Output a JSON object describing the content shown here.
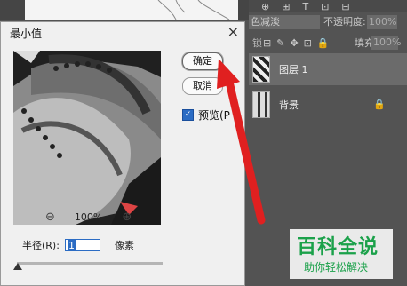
{
  "dialog": {
    "title": "最小值",
    "close_glyph": "×",
    "ok_label": "确定",
    "cancel_label": "取消",
    "preview_label": "预览(P",
    "preview_checked": true,
    "zoom_out_glyph": "⊖",
    "zoom_level": "100%",
    "zoom_in_glyph": "⊕",
    "radius_label": "半径(R):",
    "radius_value": "1",
    "radius_unit": "像素",
    "slider_level": 0
  },
  "layers_panel": {
    "tab_glyphs": [
      "⊕",
      "⊞",
      "T",
      "⊡",
      "⊟"
    ],
    "blend_mode": "色减淡",
    "opacity_label": "不透明度:",
    "opacity_value": "100%",
    "lock_label": "锁",
    "lock_icons": [
      "⊞",
      "✎",
      "✥",
      "⊡",
      "🔒"
    ],
    "fill_label": "填充:",
    "fill_value": "100%",
    "layers": [
      {
        "name": "图层 1",
        "selected": true
      },
      {
        "name": "背景",
        "selected": false,
        "locked": true
      }
    ]
  },
  "watermark": {
    "title": "百科全说",
    "subtitle": "助你轻松解决"
  },
  "colors": {
    "arrow": "#e02020",
    "watermark": "#1ba14a",
    "panel_bg": "#535353"
  }
}
